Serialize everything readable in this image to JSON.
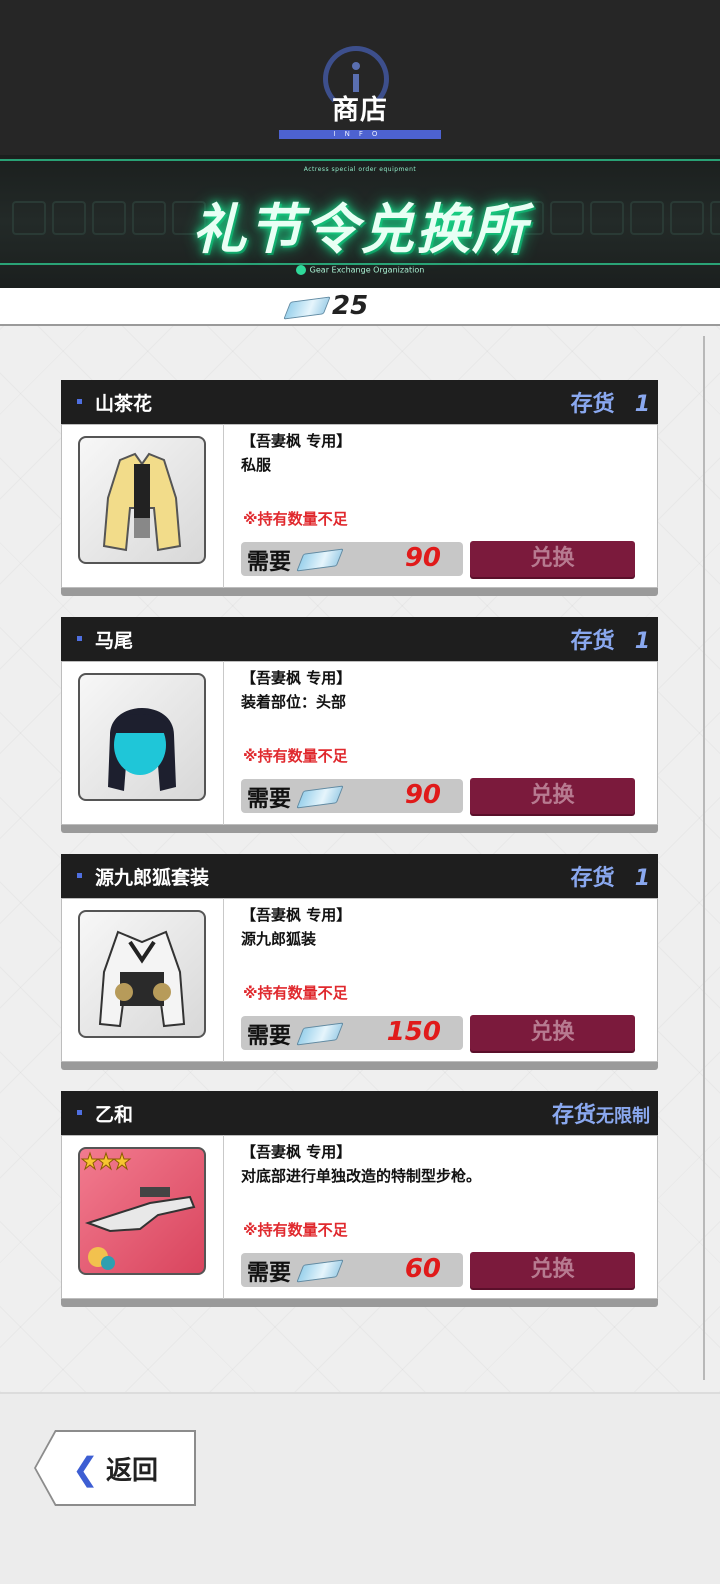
{
  "header": {
    "title": "商店",
    "info_label": "INFO"
  },
  "banner": {
    "subtitle": "Actress special order equipment",
    "title": "礼节令兑换所",
    "organization": "Gear Exchange Organization"
  },
  "currency": {
    "icon": "ticket-icon",
    "amount": "25"
  },
  "items": [
    {
      "name": "山茶花",
      "stock_label": "存货",
      "stock_value": "1",
      "exclusive": "【吾妻枫 专用】",
      "description": "私服",
      "warning": "※持有数量不足",
      "need_label": "需要",
      "cost": "90",
      "button": "兑换",
      "thumbnail": "jacket-outfit"
    },
    {
      "name": "马尾",
      "stock_label": "存货",
      "stock_value": "1",
      "exclusive": "【吾妻枫 专用】",
      "description": "装着部位：头部",
      "warning": "※持有数量不足",
      "need_label": "需要",
      "cost": "90",
      "button": "兑换",
      "thumbnail": "ponytail-hair"
    },
    {
      "name": "源九郎狐套装",
      "stock_label": "存货",
      "stock_value": "1",
      "exclusive": "【吾妻枫 专用】",
      "description": "源九郎狐装",
      "warning": "※持有数量不足",
      "need_label": "需要",
      "cost": "150",
      "button": "兑换",
      "thumbnail": "fox-costume"
    },
    {
      "name": "乙和",
      "stock_label": "存货",
      "stock_value": "无限制",
      "exclusive": "【吾妻枫 专用】",
      "description": "对底部进行单独改造的特制型步枪。",
      "warning": "※持有数量不足",
      "need_label": "需要",
      "cost": "60",
      "button": "兑换",
      "thumbnail": "rifle-weapon",
      "rarity_stars": 3
    }
  ],
  "back_button": {
    "label": "返回",
    "icon": "chevron-left-icon"
  },
  "colors": {
    "accent": "#4d62d1",
    "warning": "#e0292e",
    "exchange": "#7b1a3c",
    "banner_glow": "#19d889"
  }
}
